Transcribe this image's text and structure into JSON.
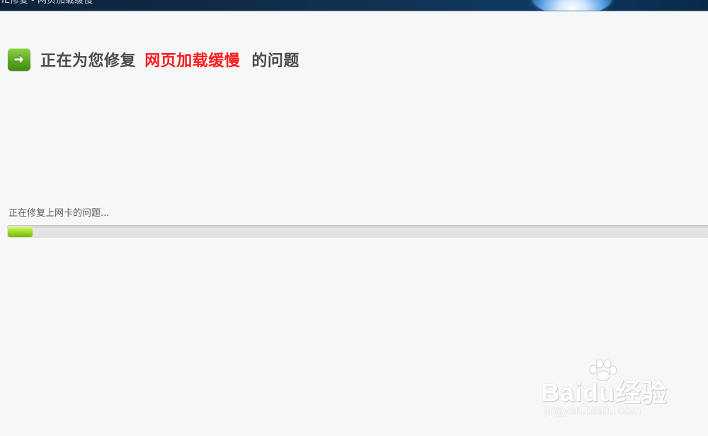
{
  "window": {
    "title": "IE修复 - 网页加载缓慢"
  },
  "heading": {
    "icon": "arrow-right-icon",
    "prefix": "正在为您修复",
    "highlight": "网页加载缓慢",
    "suffix": "的问题"
  },
  "status": {
    "text": "正在修复上网卡的问题..."
  },
  "progress": {
    "percent": 3.5
  },
  "watermark": {
    "logo": "Baidu经验",
    "url": "jingyan.baidu.com"
  },
  "colors": {
    "highlight": "#ff1a1a",
    "progress_fill": "#a6e02a",
    "icon_green": "#5aa51e",
    "background": "#f6f7f9"
  }
}
